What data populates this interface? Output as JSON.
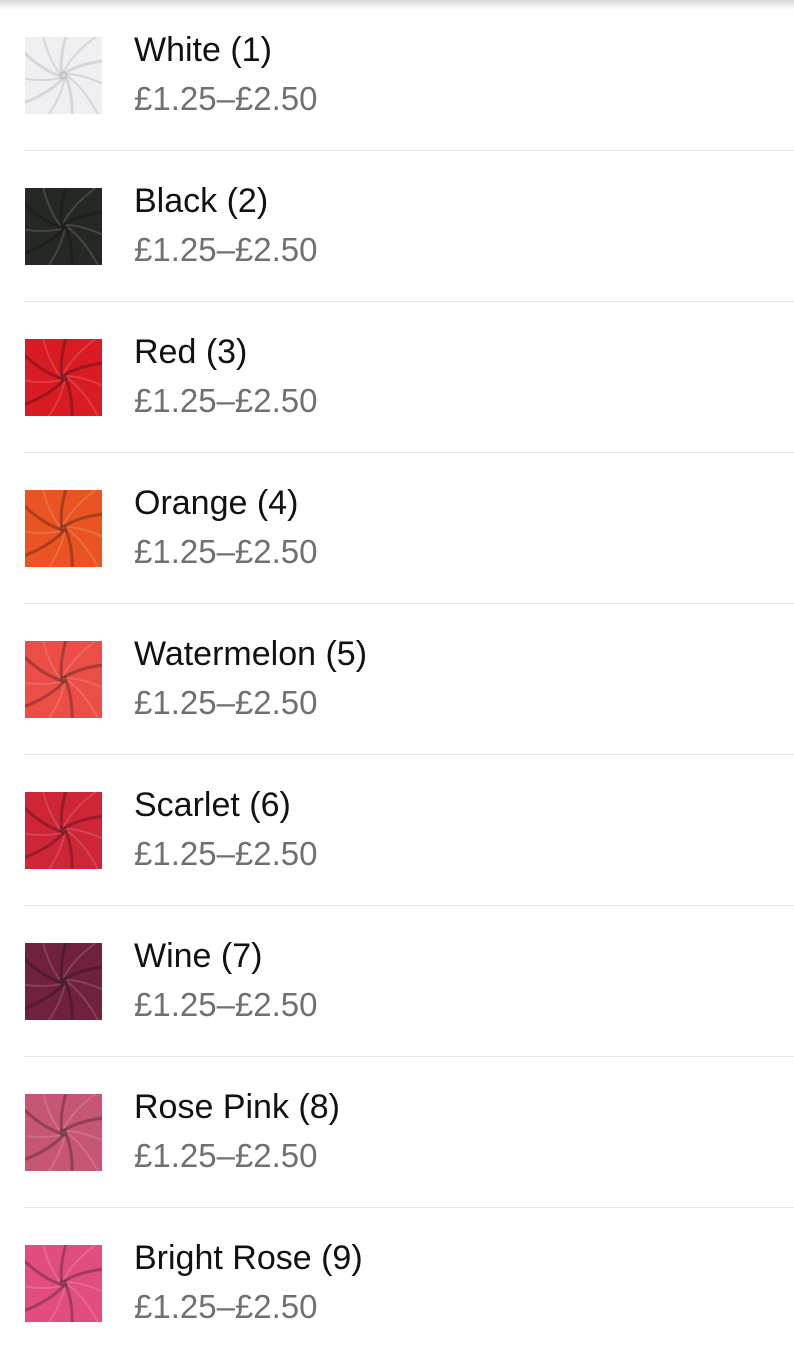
{
  "variants": [
    {
      "name": "White (1)",
      "price": "£1.25–£2.50",
      "swatch_color": "#ededf0",
      "swatch_icon": "white-fabric-swatch-icon"
    },
    {
      "name": "Black (2)",
      "price": "£1.25–£2.50",
      "swatch_color": "#1e201d",
      "swatch_icon": "black-fabric-swatch-icon"
    },
    {
      "name": "Red (3)",
      "price": "£1.25–£2.50",
      "swatch_color": "#d8121c",
      "swatch_icon": "red-fabric-swatch-icon"
    },
    {
      "name": "Orange (4)",
      "price": "£1.25–£2.50",
      "swatch_color": "#e94e1a",
      "swatch_icon": "orange-fabric-swatch-icon"
    },
    {
      "name": "Watermelon (5)",
      "price": "£1.25–£2.50",
      "swatch_color": "#ea4740",
      "swatch_icon": "watermelon-fabric-swatch-icon"
    },
    {
      "name": "Scarlet (6)",
      "price": "£1.25–£2.50",
      "swatch_color": "#cc1d2f",
      "swatch_icon": "scarlet-fabric-swatch-icon"
    },
    {
      "name": "Wine (7)",
      "price": "£1.25–£2.50",
      "swatch_color": "#6b1838",
      "swatch_icon": "wine-fabric-swatch-icon"
    },
    {
      "name": "Rose Pink (8)",
      "price": "£1.25–£2.50",
      "swatch_color": "#c4506f",
      "swatch_icon": "rose-pink-fabric-swatch-icon"
    },
    {
      "name": "Bright Rose (9)",
      "price": "£1.25–£2.50",
      "swatch_color": "#e0467a",
      "swatch_icon": "bright-rose-fabric-swatch-icon"
    }
  ]
}
